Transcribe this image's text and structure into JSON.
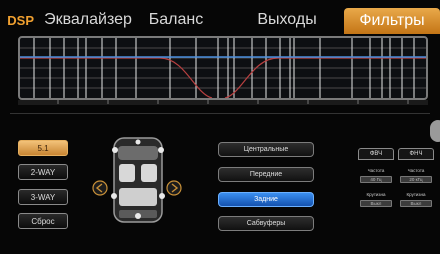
{
  "tabs": {
    "dsp": "DSP",
    "equalizer": "Эквалайзер",
    "balance": "Баланс",
    "outputs": "Выходы",
    "filters": "Фильтры"
  },
  "speaker_modes": [
    "5.1",
    "2-WAY",
    "3-WAY",
    "Сброс"
  ],
  "channels": [
    "Центральные",
    "Передние",
    "Задние",
    "Сабвуферы"
  ],
  "filter_panel": {
    "hpf_label": "ФВЧ",
    "lpf_label": "ФНЧ",
    "frequency_label": "Частота",
    "frequency_hpf_value": "40 Гц",
    "frequency_lpf_value": "20 кГц",
    "slope_label": "Крутизна",
    "slope_hpf_value": "Выкл",
    "slope_lpf_value": "Выкл"
  },
  "colors": {
    "accent_orange": "#e39a3a",
    "active_blue": "#2f7de0",
    "curve_blue": "#4a8fe0",
    "curve_red": "#b84040"
  }
}
